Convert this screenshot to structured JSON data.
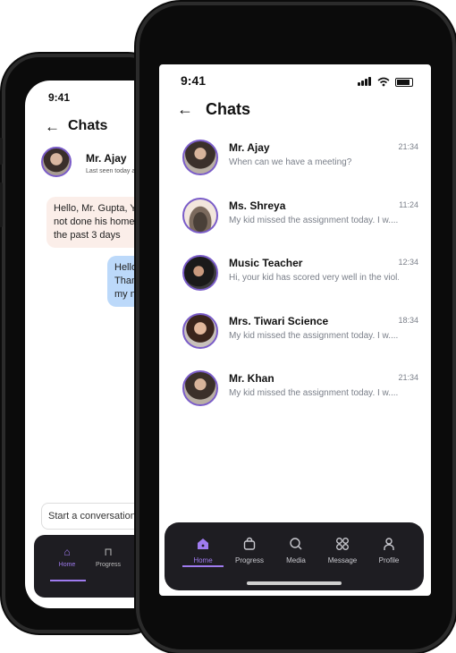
{
  "back_phone": {
    "time": "9:41",
    "back_icon": "arrow-left-icon",
    "title": "Chats",
    "contact_name": "Mr. Ajay",
    "last_seen": "Last seen today at",
    "incoming_message": "Hello, Mr. Gupta, Yo\nnot done his homev\nthe past 3 days",
    "outgoing_message": "Hello,\nThank\nmy no",
    "input_placeholder": "Start a conversation...",
    "nav": [
      {
        "label": "Home",
        "icon": "home-icon",
        "active": true
      },
      {
        "label": "Progress",
        "icon": "bag-icon",
        "active": false
      }
    ]
  },
  "status_bar": {
    "time": "9:41",
    "icons": [
      "signal-icon",
      "wifi-icon",
      "battery-icon"
    ]
  },
  "header": {
    "back_icon": "arrow-left-icon",
    "title": "Chats"
  },
  "chats": [
    {
      "name": "Mr. Ajay",
      "preview": "When can we have a meeting?",
      "time": "21:34"
    },
    {
      "name": "Ms. Shreya",
      "preview": "My kid missed the assignment today. I w....",
      "time": "11:24"
    },
    {
      "name": "Music Teacher",
      "preview": "Hi, your kid has scored very well in the viol....",
      "time": "12:34"
    },
    {
      "name": "Mrs. Tiwari Science",
      "preview": "My kid missed the assignment today. I w....",
      "time": "18:34"
    },
    {
      "name": "Mr. Khan",
      "preview": "My kid missed the assignment today. I w....",
      "time": "21:34"
    }
  ],
  "bottom_nav": {
    "items": [
      {
        "label": "Home",
        "icon": "home-icon",
        "active": true
      },
      {
        "label": "Progress",
        "icon": "bag-icon",
        "active": false
      },
      {
        "label": "Media",
        "icon": "search-icon",
        "active": false
      },
      {
        "label": "Message",
        "icon": "grid-icon",
        "active": false
      },
      {
        "label": "Profile",
        "icon": "user-icon",
        "active": false
      }
    ]
  },
  "colors": {
    "accent": "#9f7bef",
    "nav_background": "#1e1d22",
    "incoming_bubble": "#fbeee9",
    "outgoing_bubble": "#bcd9fa"
  }
}
